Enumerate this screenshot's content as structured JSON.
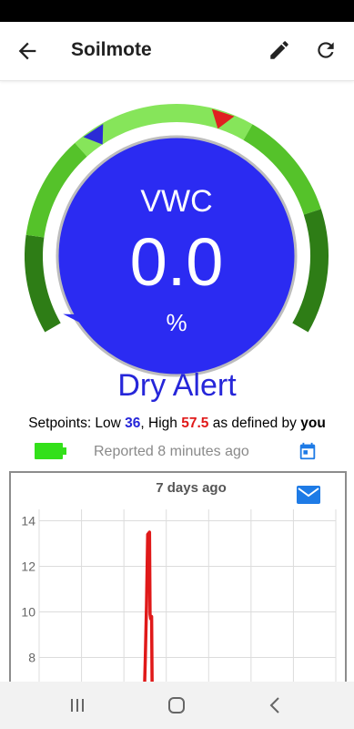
{
  "app": {
    "title": "Soilmote",
    "icons": {
      "back": "arrow-back-icon",
      "edit": "pencil-icon",
      "refresh": "refresh-icon"
    }
  },
  "gauge": {
    "label": "VWC",
    "value": "0.0",
    "unit": "%",
    "reading": 0.0,
    "setpoint_low": 36,
    "setpoint_high": 57.5,
    "colors": {
      "dial": "#2b2bf2",
      "dial_border": "#bdbdbd",
      "arc_dark": "#2e7d16",
      "arc_mid": "#55c22a",
      "arc_light": "#86e55a",
      "low_marker": "#2b2bd6",
      "high_marker": "#e02020"
    }
  },
  "status": {
    "label": "Dry Alert",
    "color": "#2626d9"
  },
  "setpoints": {
    "prefix": "Setpoints: Low ",
    "low": "36",
    "middle": ", High ",
    "high": "57.5",
    "suffix": " as defined by ",
    "owner": "you"
  },
  "report": {
    "text": "Reported 8 minutes ago",
    "battery_color": "#33e01a",
    "icons": {
      "battery": "battery-full-icon",
      "calendar": "calendar-icon"
    }
  },
  "chart_data": {
    "type": "line",
    "title": "7 days ago",
    "y_ticks": [
      "14",
      "12",
      "10",
      "8"
    ],
    "ylim": [
      6.5,
      14.5
    ],
    "grid": true,
    "series": [
      {
        "color": "#e01919",
        "points": [
          [
            0.355,
            6.5
          ],
          [
            0.358,
            8.0
          ],
          [
            0.362,
            10.3
          ],
          [
            0.366,
            13.4
          ],
          [
            0.372,
            13.5
          ],
          [
            0.374,
            9.9
          ],
          [
            0.376,
            9.7
          ],
          [
            0.379,
            9.8
          ],
          [
            0.381,
            6.5
          ]
        ]
      }
    ],
    "icons": {
      "share": "mail-icon"
    }
  },
  "navbar": {
    "icons": [
      "recent-apps-icon",
      "home-icon",
      "back-icon"
    ]
  }
}
